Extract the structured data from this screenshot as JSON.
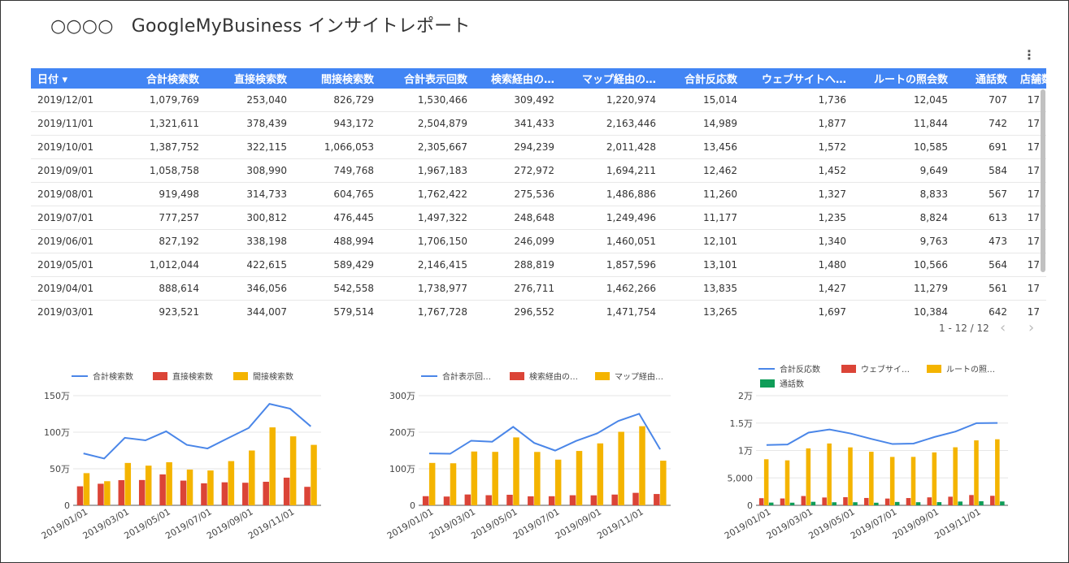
{
  "report": {
    "title": "○○○○　GoogleMyBusiness インサイトレポート"
  },
  "table": {
    "headers": [
      "日付 ▾",
      "合計検索数",
      "直接検索数",
      "間接検索数",
      "合計表示回数",
      "検索経由の…",
      "マップ経由の…",
      "合計反応数",
      "ウェブサイトへ…",
      "ルートの照会数",
      "通話数",
      "店舗数"
    ],
    "rows": [
      [
        "2019/12/01",
        "1,079,769",
        "253,040",
        "826,729",
        "1,530,466",
        "309,492",
        "1,220,974",
        "15,014",
        "1,736",
        "12,045",
        "707",
        "17"
      ],
      [
        "2019/11/01",
        "1,321,611",
        "378,439",
        "943,172",
        "2,504,879",
        "341,433",
        "2,163,446",
        "14,989",
        "1,877",
        "11,844",
        "742",
        "17"
      ],
      [
        "2019/10/01",
        "1,387,752",
        "322,115",
        "1,066,053",
        "2,305,667",
        "294,239",
        "2,011,428",
        "13,456",
        "1,572",
        "10,585",
        "691",
        "17"
      ],
      [
        "2019/09/01",
        "1,058,758",
        "308,990",
        "749,768",
        "1,967,183",
        "272,972",
        "1,694,211",
        "12,462",
        "1,452",
        "9,649",
        "584",
        "17"
      ],
      [
        "2019/08/01",
        "919,498",
        "314,733",
        "604,765",
        "1,762,422",
        "275,536",
        "1,486,886",
        "11,260",
        "1,327",
        "8,833",
        "567",
        "17"
      ],
      [
        "2019/07/01",
        "777,257",
        "300,812",
        "476,445",
        "1,497,322",
        "248,648",
        "1,249,496",
        "11,177",
        "1,235",
        "8,824",
        "613",
        "17"
      ],
      [
        "2019/06/01",
        "827,192",
        "338,198",
        "488,994",
        "1,706,150",
        "246,099",
        "1,460,051",
        "12,101",
        "1,340",
        "9,763",
        "473",
        "17"
      ],
      [
        "2019/05/01",
        "1,012,044",
        "422,615",
        "589,429",
        "2,146,415",
        "288,819",
        "1,857,596",
        "13,101",
        "1,480",
        "10,566",
        "564",
        "17"
      ],
      [
        "2019/04/01",
        "888,614",
        "346,056",
        "542,558",
        "1,738,977",
        "276,711",
        "1,462,266",
        "13,835",
        "1,427",
        "11,279",
        "561",
        "17"
      ],
      [
        "2019/03/01",
        "923,521",
        "344,007",
        "579,514",
        "1,767,728",
        "296,552",
        "1,471,754",
        "13,265",
        "1,697",
        "10,384",
        "642",
        "17"
      ]
    ],
    "pagination": "1 - 12 / 12"
  },
  "colors": {
    "line": "#4a86e8",
    "red": "#db4437",
    "yellow": "#f4b400",
    "green": "#0f9d58",
    "header": "#4285f4"
  },
  "chart_data": [
    {
      "type": "bar",
      "x": [
        "2019/01/01",
        "2019/02/01",
        "2019/03/01",
        "2019/04/01",
        "2019/05/01",
        "2019/06/01",
        "2019/07/01",
        "2019/08/01",
        "2019/09/01",
        "2019/10/01",
        "2019/11/01",
        "2019/12/01"
      ],
      "x_tick_labels": [
        "2019/01/01",
        "2019/03/01",
        "2019/05/01",
        "2019/07/01",
        "2019/09/01",
        "2019/11/01"
      ],
      "y_ticks": [
        "0",
        "50万",
        "100万",
        "150万"
      ],
      "ylim": [
        0,
        1500000
      ],
      "series": [
        {
          "name": "合計検索数",
          "kind": "line",
          "values": [
            710000,
            640000,
            923521,
            888614,
            1012044,
            827192,
            777257,
            919498,
            1058758,
            1387752,
            1321611,
            1079769
          ]
        },
        {
          "name": "直接検索数",
          "kind": "bar",
          "values": [
            260000,
            295000,
            344007,
            346056,
            422615,
            338198,
            300812,
            314733,
            308990,
            322115,
            378439,
            253040
          ]
        },
        {
          "name": "間接検索数",
          "kind": "bar",
          "values": [
            440000,
            330000,
            579514,
            542558,
            589429,
            488994,
            476445,
            604765,
            749768,
            1066053,
            943172,
            826729
          ]
        }
      ]
    },
    {
      "type": "bar",
      "x": [
        "2019/01/01",
        "2019/02/01",
        "2019/03/01",
        "2019/04/01",
        "2019/05/01",
        "2019/06/01",
        "2019/07/01",
        "2019/08/01",
        "2019/09/01",
        "2019/10/01",
        "2019/11/01",
        "2019/12/01"
      ],
      "x_tick_labels": [
        "2019/01/01",
        "2019/03/01",
        "2019/05/01",
        "2019/07/01",
        "2019/09/01",
        "2019/11/01"
      ],
      "y_ticks": [
        "0",
        "100万",
        "200万",
        "300万"
      ],
      "ylim": [
        0,
        3000000
      ],
      "series": [
        {
          "name": "合計表示回…",
          "kind": "line",
          "values": [
            1420000,
            1410000,
            1767728,
            1738977,
            2146415,
            1706150,
            1497322,
            1762422,
            1967183,
            2305667,
            2504879,
            1530466
          ]
        },
        {
          "name": "検索経由の…",
          "kind": "bar",
          "values": [
            250000,
            240000,
            296552,
            276711,
            288819,
            246099,
            248648,
            275536,
            272972,
            294239,
            341433,
            309492
          ]
        },
        {
          "name": "マップ経由…",
          "kind": "bar",
          "values": [
            1160000,
            1150000,
            1471754,
            1462266,
            1857596,
            1460051,
            1249496,
            1486886,
            1694211,
            2011428,
            2163446,
            1220974
          ]
        }
      ]
    },
    {
      "type": "bar",
      "x": [
        "2019/01/01",
        "2019/02/01",
        "2019/03/01",
        "2019/04/01",
        "2019/05/01",
        "2019/06/01",
        "2019/07/01",
        "2019/08/01",
        "2019/09/01",
        "2019/10/01",
        "2019/11/01",
        "2019/12/01"
      ],
      "x_tick_labels": [
        "2019/01/01",
        "2019/03/01",
        "2019/05/01",
        "2019/07/01",
        "2019/09/01",
        "2019/11/01"
      ],
      "y_ticks": [
        "0",
        "5,000",
        "1万",
        "1.5万",
        "2万"
      ],
      "ylim": [
        0,
        20000
      ],
      "series": [
        {
          "name": "合計反応数",
          "kind": "line",
          "values": [
            11000,
            11100,
            13265,
            13835,
            13101,
            12101,
            11177,
            11260,
            12462,
            13456,
            14989,
            15014
          ]
        },
        {
          "name": "ウェブサイ…",
          "kind": "bar",
          "values": [
            1300,
            1250,
            1697,
            1427,
            1480,
            1340,
            1235,
            1327,
            1452,
            1572,
            1877,
            1736
          ]
        },
        {
          "name": "ルートの照…",
          "kind": "bar",
          "values": [
            8400,
            8200,
            10384,
            11279,
            10566,
            9763,
            8824,
            8833,
            9649,
            10585,
            11844,
            12045
          ]
        },
        {
          "name": "通話数",
          "kind": "bar",
          "values": [
            500,
            480,
            642,
            561,
            564,
            473,
            613,
            567,
            584,
            691,
            742,
            707
          ]
        }
      ]
    }
  ]
}
